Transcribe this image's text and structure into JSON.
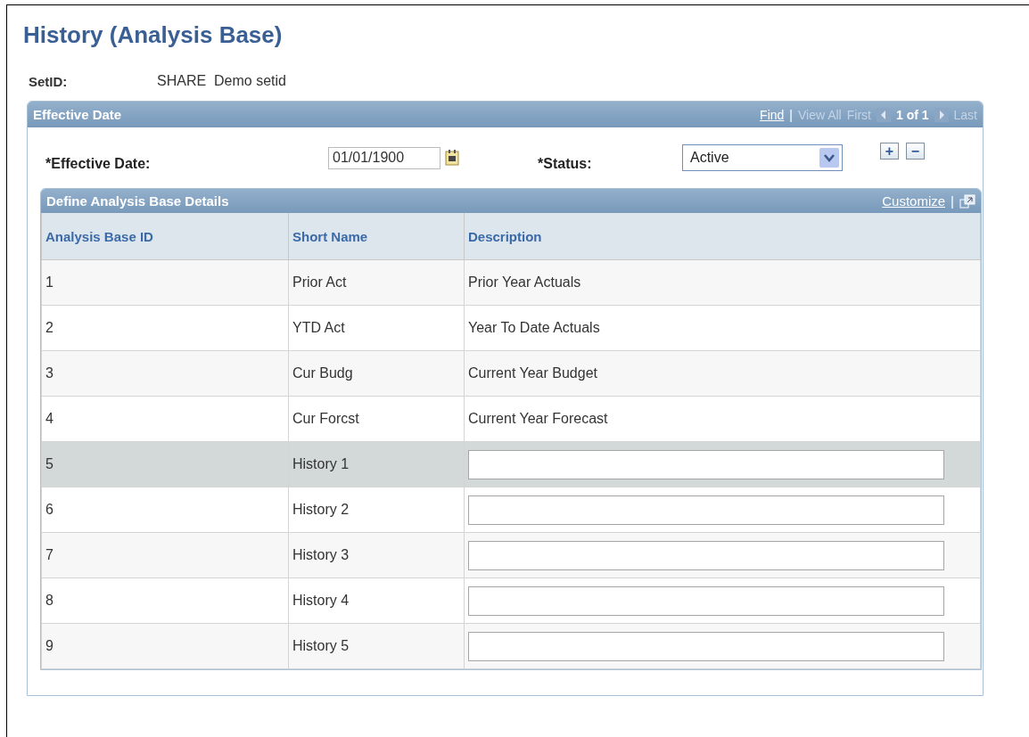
{
  "title": "History (Analysis Base)",
  "setid": {
    "label": "SetID:",
    "code": "SHARE",
    "description": "Demo setid"
  },
  "effective_panel": {
    "title": "Effective Date",
    "find": "Find",
    "separator": "|",
    "view_all": "View All",
    "first": "First",
    "count": "1 of 1",
    "last": "Last",
    "date_label": "*Effective Date:",
    "date_value": "01/01/1900",
    "status_label": "*Status:",
    "status_value": "Active",
    "add": "+",
    "remove": "−"
  },
  "grid": {
    "title": "Define Analysis Base Details",
    "customize": "Customize",
    "separator": "|",
    "columns": [
      "Analysis Base ID",
      "Short Name",
      "Description"
    ],
    "rows": [
      {
        "id": "1",
        "short_name": "Prior Act",
        "kind": "text",
        "description": "Prior Year Actuals",
        "selected": false
      },
      {
        "id": "2",
        "short_name": "YTD Act",
        "kind": "text",
        "description": "Year To Date Actuals",
        "selected": false
      },
      {
        "id": "3",
        "short_name": "Cur Budg",
        "kind": "text",
        "description": "Current Year Budget",
        "selected": false
      },
      {
        "id": "4",
        "short_name": "Cur Forcst",
        "kind": "text",
        "description": "Current Year Forecast",
        "selected": false
      },
      {
        "id": "5",
        "short_name": "History 1",
        "kind": "input",
        "selected": true
      },
      {
        "id": "6",
        "short_name": "History 2",
        "kind": "input",
        "selected": false
      },
      {
        "id": "7",
        "short_name": "History 3",
        "kind": "input",
        "selected": false
      },
      {
        "id": "8",
        "short_name": "History 4",
        "kind": "input",
        "selected": false
      },
      {
        "id": "9",
        "short_name": "History 5",
        "kind": "input",
        "selected": false
      }
    ]
  }
}
